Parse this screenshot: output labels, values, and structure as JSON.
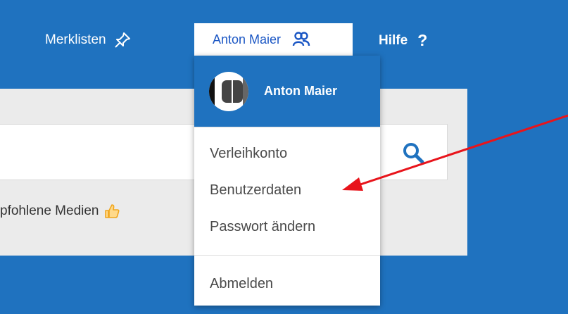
{
  "nav": {
    "merklisten": "Merklisten",
    "user_name": "Anton Maier",
    "hilfe": "Hilfe",
    "help_symbol": "?"
  },
  "search": {
    "recommended_label": "pfohlene Medien"
  },
  "dropdown": {
    "header_name": "Anton Maier",
    "items": [
      "Verleihkonto",
      "Benutzerdaten",
      "Passwort ändern"
    ],
    "logout": "Abmelden"
  },
  "colors": {
    "brand_blue": "#1f72bf",
    "link_blue": "#1a56c4",
    "thumb_orange": "#f0a61e",
    "arrow_red": "#e8141b"
  },
  "icons": [
    "pushpin-icon",
    "users-icon",
    "search-icon",
    "thumbs-up-icon",
    "avatar-logo"
  ]
}
